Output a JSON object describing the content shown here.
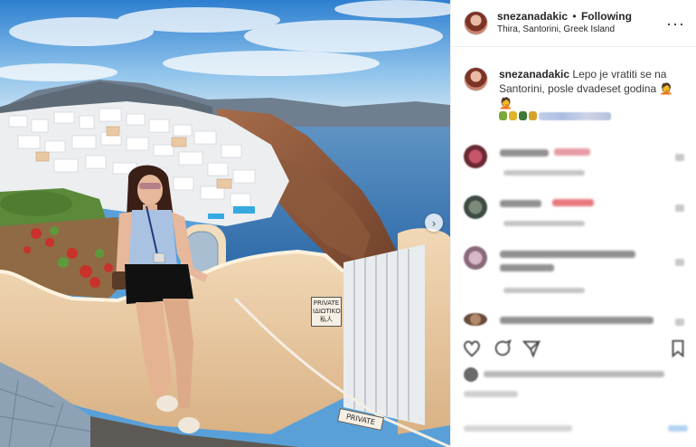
{
  "header": {
    "username": "snezanadakic",
    "separator": "•",
    "follow_label": "Following",
    "location": "Thira, Santorini, Greek Island",
    "more_icon": "more-horizontal-icon"
  },
  "caption": {
    "username": "snezanadakic",
    "text": "Lepo je vratiti se na Santorini, posle dvadeset godina",
    "emoji_tail": "🤦🤦"
  },
  "photo": {
    "sign_private_lines": [
      "PRIVATE",
      "ΙΔΙΩΤΙΚΟ",
      "私人"
    ],
    "sign_bottom": "PRIVATE",
    "next_icon": "chevron-right-icon"
  },
  "comments_count_visible": 4,
  "actions": {
    "like_icon": "heart-icon",
    "comment_icon": "comment-icon",
    "share_icon": "share-icon",
    "save_icon": "bookmark-icon"
  },
  "colors": {
    "text": "#262626",
    "border": "#efefef",
    "sky": "#5aa0d8",
    "sea": "#3b78b5"
  }
}
